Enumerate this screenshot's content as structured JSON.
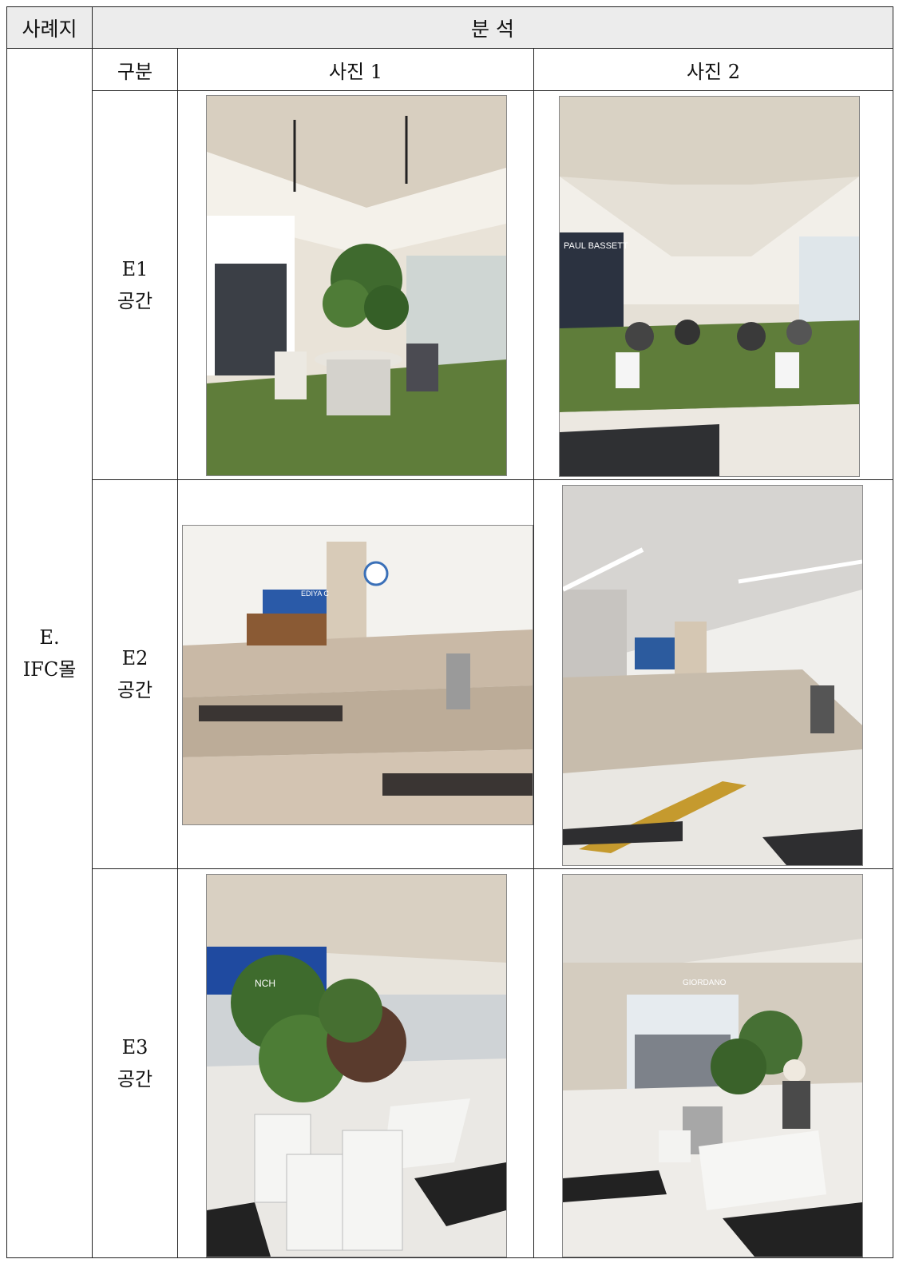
{
  "header": {
    "site": "사례지",
    "analysis": "분 석"
  },
  "subheader": {
    "category": "구분",
    "photo1": "사진 1",
    "photo2": "사진 2"
  },
  "site_name": {
    "line1": "E.",
    "line2": "IFC몰"
  },
  "rows": [
    {
      "label1": "E1",
      "label2": "공간"
    },
    {
      "label1": "E2",
      "label2": "공간"
    },
    {
      "label1": "E3",
      "label2": "공간"
    }
  ],
  "photo_text": {
    "paul_bassett": "PAUL BASSETT",
    "ediya": "EDIYA C",
    "giordano": "GIORDANO",
    "munch": "NCH"
  },
  "colors": {
    "header_bg": "#ececec",
    "border": "#222222",
    "grass": "#5f7d3a",
    "marble": "#d9d2c6"
  }
}
